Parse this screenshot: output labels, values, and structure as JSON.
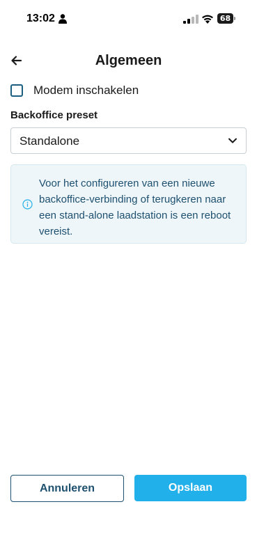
{
  "status_bar": {
    "time": "13:02",
    "battery": "68",
    "icons": [
      "person-icon",
      "signal-icon",
      "wifi-icon",
      "battery-icon"
    ]
  },
  "header": {
    "title": "Algemeen",
    "back_icon": "arrow-left-icon"
  },
  "form": {
    "modem_checkbox": {
      "label": "Modem inschakelen",
      "checked": false
    },
    "backoffice": {
      "label": "Backoffice preset",
      "value": "Standalone",
      "icon": "chevron-down-icon"
    },
    "info": {
      "icon": "info-icon",
      "text": "Voor het configureren van een nieuwe backoffice-verbinding of terugkeren naar een stand-alone laadstation is een reboot vereist."
    }
  },
  "footer": {
    "cancel_label": "Annuleren",
    "save_label": "Opslaan"
  },
  "colors": {
    "primary": "#22b0ea",
    "dark_accent": "#1e5070",
    "info_bg": "#eef6f9"
  }
}
